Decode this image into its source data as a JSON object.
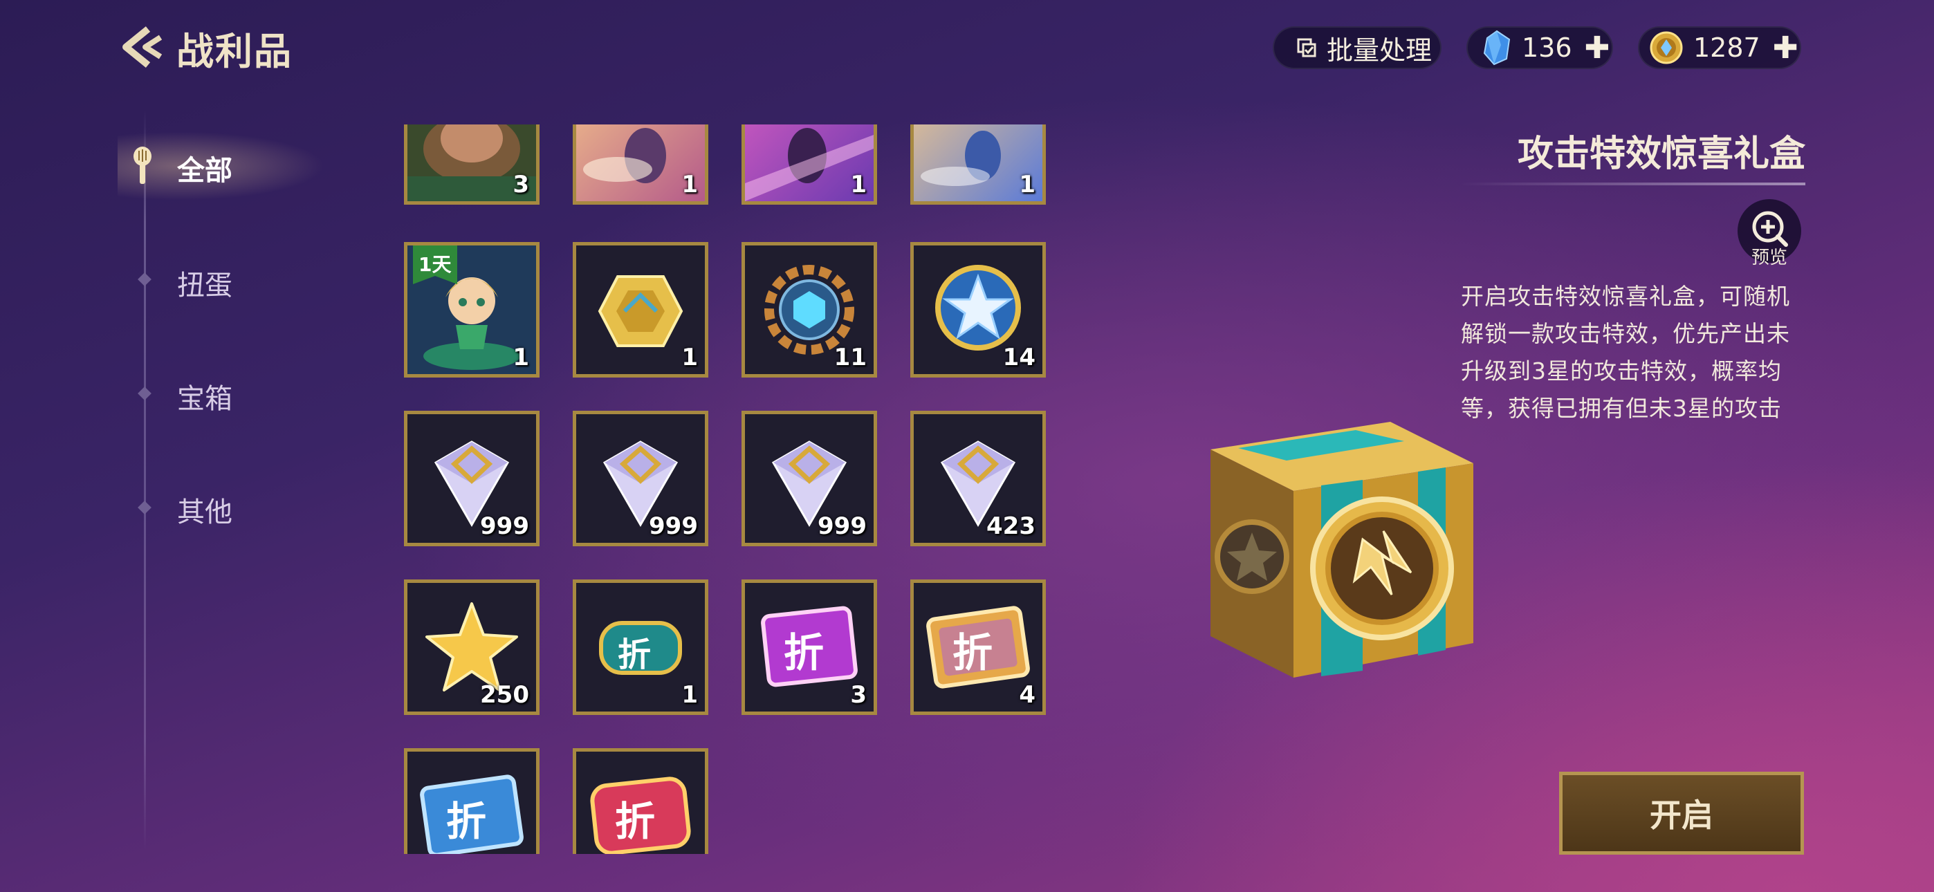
{
  "header": {
    "title": "战利品",
    "batch_label": "批量处理",
    "gem_count": "136",
    "coin_count": "1287"
  },
  "sidebar": {
    "items": [
      {
        "label": "全部",
        "active": true
      },
      {
        "label": "扭蛋",
        "active": false
      },
      {
        "label": "宝箱",
        "active": false
      },
      {
        "label": "其他",
        "active": false
      }
    ]
  },
  "items": [
    {
      "icon": "little-legend-pig",
      "count": "3"
    },
    {
      "icon": "arena-skin-fire",
      "count": "1"
    },
    {
      "icon": "arena-skin-purple",
      "count": "1"
    },
    {
      "icon": "arena-skin-blue",
      "count": "1"
    },
    {
      "icon": "little-legend-fairy",
      "count": "1",
      "badge": "1天"
    },
    {
      "icon": "gold-emblem",
      "count": "1"
    },
    {
      "icon": "blue-gear-orb",
      "count": "11"
    },
    {
      "icon": "star-medallion",
      "count": "14"
    },
    {
      "icon": "diamond-crystal",
      "count": "999"
    },
    {
      "icon": "diamond-crystal",
      "count": "999"
    },
    {
      "icon": "diamond-crystal",
      "count": "999"
    },
    {
      "icon": "diamond-crystal",
      "count": "423"
    },
    {
      "icon": "gold-star",
      "count": "250"
    },
    {
      "icon": "discount-coupon-teal",
      "count": "1",
      "glyph": "折"
    },
    {
      "icon": "discount-coupon-purple",
      "count": "3",
      "glyph": "折"
    },
    {
      "icon": "discount-coupon-gold",
      "count": "4",
      "glyph": "折"
    },
    {
      "icon": "discount-coupon-blue",
      "count": "",
      "glyph": "折"
    },
    {
      "icon": "discount-coupon-red",
      "count": "",
      "glyph": "折"
    }
  ],
  "detail": {
    "title": "攻击特效惊喜礼盒",
    "preview_label": "预览",
    "description": "开启攻击特效惊喜礼盒，可随机解锁一款攻击特效，优先产出未升级到3星的攻击特效，概率均等，获得已拥有但未3星的攻击",
    "open_label": "开启"
  },
  "colors": {
    "tile_border": "#a78941",
    "tile_bg": "#1f1d2e",
    "button_bg": "#5a4020",
    "accent_gold": "#e8c66a"
  }
}
